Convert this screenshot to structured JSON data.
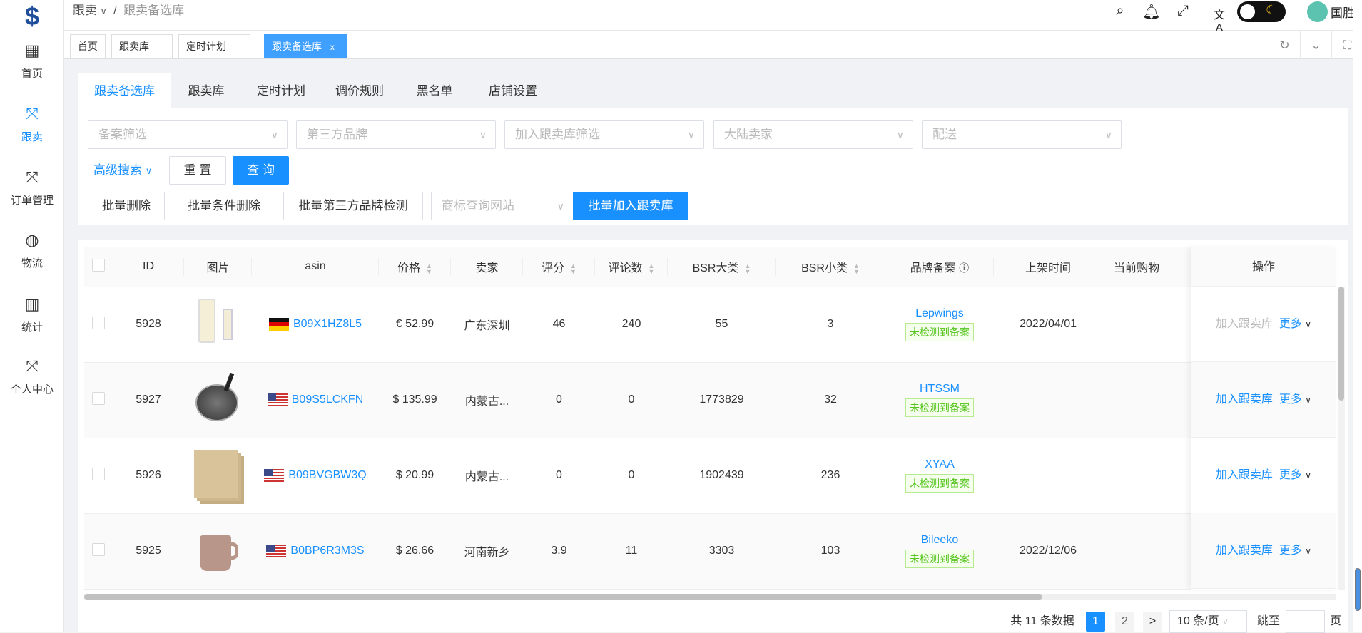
{
  "header": {
    "breadcrumb": [
      "跟卖",
      "跟卖备选库"
    ],
    "user_name": "国胜",
    "icons": [
      "search-icon",
      "bell-icon",
      "fullscreen-icon",
      "translate-icon",
      "theme-toggle",
      "avatar"
    ]
  },
  "sidebar": {
    "items": [
      {
        "label": "首页",
        "icon": "grid-icon"
      },
      {
        "label": "跟卖",
        "icon": "compress-icon",
        "active": true
      },
      {
        "label": "订单管理",
        "icon": "compress-icon"
      },
      {
        "label": "物流",
        "icon": "globe-icon"
      },
      {
        "label": "统计",
        "icon": "bar-chart-icon"
      },
      {
        "label": "个人中心",
        "icon": "compress-icon"
      }
    ]
  },
  "page_tabs": [
    {
      "label": "首页"
    },
    {
      "label": "跟卖库"
    },
    {
      "label": "定时计划"
    },
    {
      "label": "跟卖备选库",
      "active": true,
      "close": "x"
    }
  ],
  "inner_tabs": [
    "跟卖备选库",
    "跟卖库",
    "定时计划",
    "调价规则",
    "黑名单",
    "店铺设置"
  ],
  "filters": {
    "placeholders": [
      "备案筛选",
      "第三方品牌",
      "加入跟卖库筛选",
      "大陆卖家",
      "配送"
    ],
    "advanced": "高级搜索",
    "reset": "重 置",
    "query": "查 询"
  },
  "batch": {
    "delete": "批量删除",
    "cond_delete": "批量条件删除",
    "brand_check": "批量第三方品牌检测",
    "site_placeholder": "商标查询网站",
    "add": "批量加入跟卖库"
  },
  "table": {
    "columns": [
      "ID",
      "图片",
      "asin",
      "价格",
      "卖家",
      "评分",
      "评论数",
      "BSR大类",
      "BSR小类",
      "品牌备案",
      "上架时间",
      "当前购物",
      "操作"
    ],
    "rows": [
      {
        "id": "5928",
        "flag": "de",
        "asin": "B09X1HZ8L5",
        "price": "€ 52.99",
        "seller": "广东深圳",
        "rating": "46",
        "reviews": "240",
        "bsr_big": "55",
        "bsr_small": "3",
        "brand": "Lepwings",
        "brand_tag": "未检测到备案",
        "date": "2022/04/01",
        "add": "加入跟卖库",
        "add_disabled": true,
        "more": "更多"
      },
      {
        "id": "5927",
        "flag": "us",
        "asin": "B09S5LCKFN",
        "price": "$ 135.99",
        "seller": "内蒙古...",
        "rating": "0",
        "reviews": "0",
        "bsr_big": "1773829",
        "bsr_small": "32",
        "brand": "HTSSM",
        "brand_tag": "未检测到备案",
        "date": "",
        "add": "加入跟卖库",
        "more": "更多"
      },
      {
        "id": "5926",
        "flag": "us",
        "asin": "B09BVGBW3Q",
        "price": "$ 20.99",
        "seller": "内蒙古...",
        "rating": "0",
        "reviews": "0",
        "bsr_big": "1902439",
        "bsr_small": "236",
        "brand": "XYAA",
        "brand_tag": "未检测到备案",
        "date": "",
        "add": "加入跟卖库",
        "more": "更多"
      },
      {
        "id": "5925",
        "flag": "us",
        "asin": "B0BP6R3M3S",
        "price": "$ 26.66",
        "seller": "河南新乡",
        "rating": "3.9",
        "reviews": "11",
        "bsr_big": "3303",
        "bsr_small": "103",
        "brand": "Bileeko",
        "brand_tag": "未检测到备案",
        "date": "2022/12/06",
        "add": "加入跟卖库",
        "more": "更多"
      }
    ]
  },
  "pagination": {
    "total": "共 11 条数据",
    "pages": [
      "1",
      "2"
    ],
    "current": "1",
    "next": ">",
    "page_size": "10 条/页",
    "jump_label": "跳至",
    "jump_suffix": "页"
  },
  "colors": {
    "primary": "#1890ff",
    "tag_green": "#52c41a"
  }
}
